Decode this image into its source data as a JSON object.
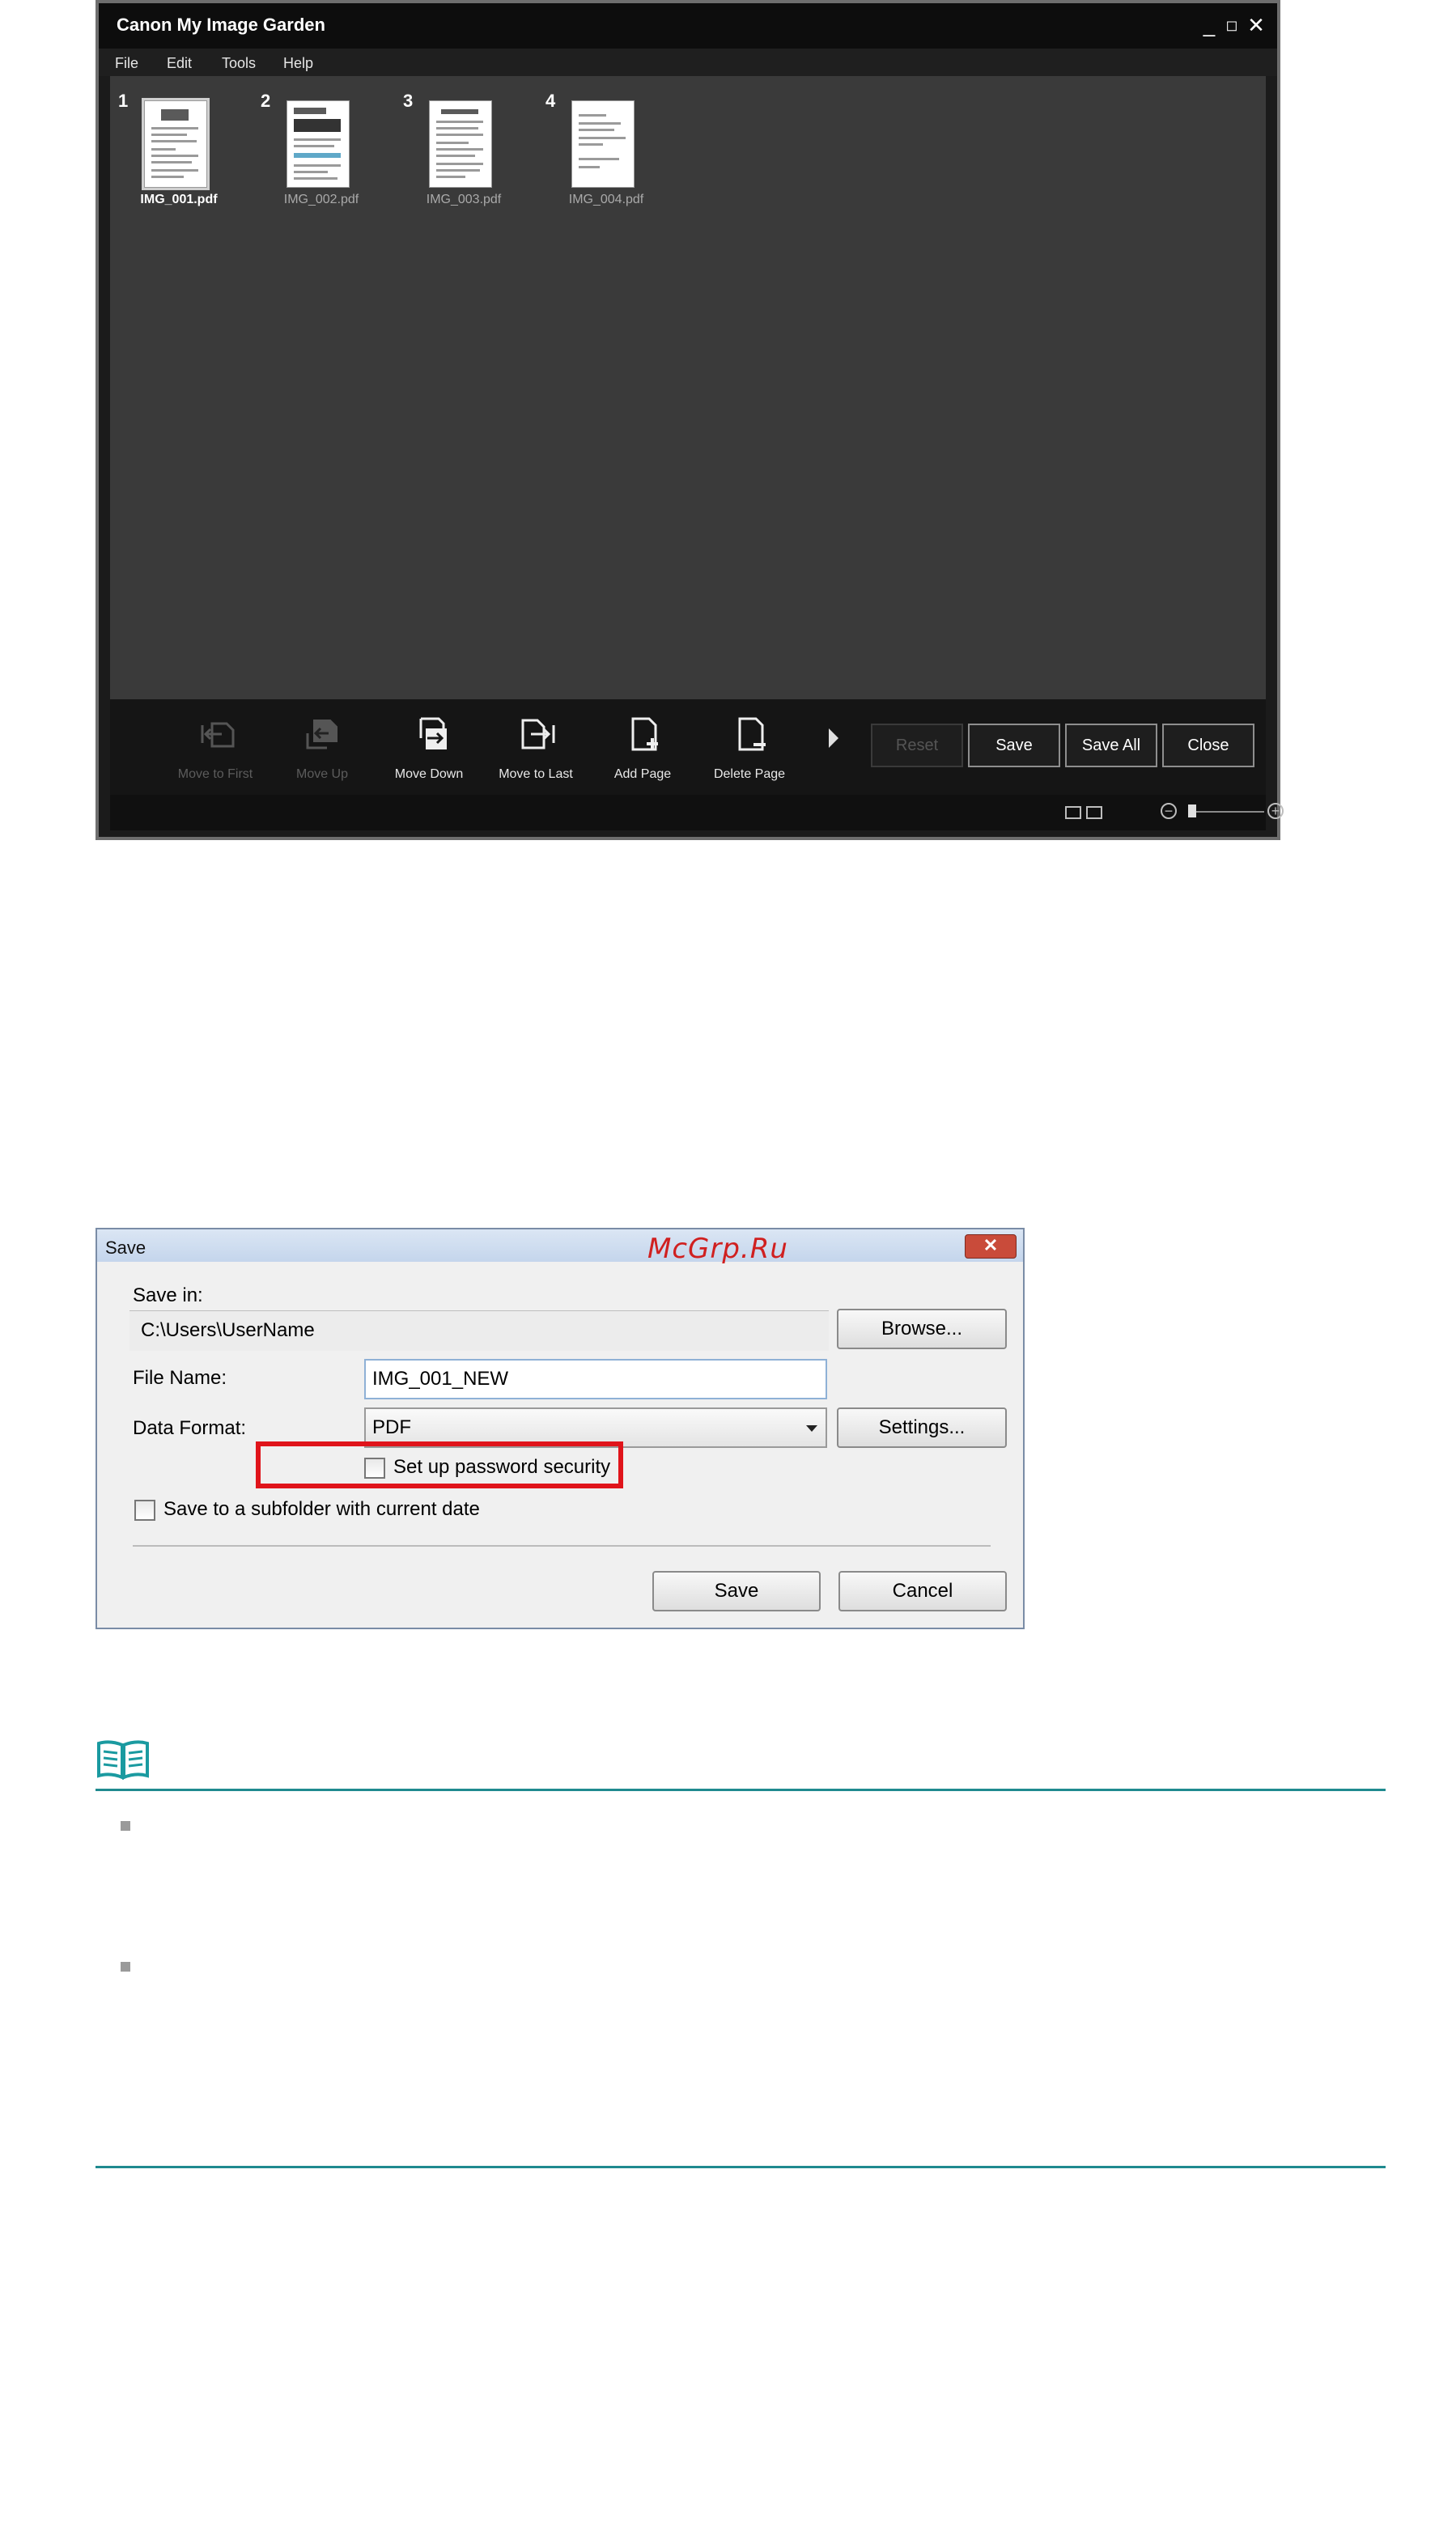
{
  "app": {
    "title": "Canon My Image Garden",
    "window_controls": [
      "minimize",
      "maximize",
      "close"
    ],
    "menu": [
      "File",
      "Edit",
      "Tools",
      "Help"
    ],
    "thumbnails": [
      {
        "number": "1",
        "filename": "IMG_001.pdf",
        "selected": true
      },
      {
        "number": "2",
        "filename": "IMG_002.pdf",
        "selected": false
      },
      {
        "number": "3",
        "filename": "IMG_003.pdf",
        "selected": false
      },
      {
        "number": "4",
        "filename": "IMG_004.pdf",
        "selected": false
      }
    ],
    "toolbar": {
      "move_to_first": "Move to First",
      "move_up": "Move Up",
      "move_down": "Move Down",
      "move_to_last": "Move to Last",
      "add_page": "Add Page",
      "delete_page": "Delete Page"
    },
    "buttons": {
      "reset": "Reset",
      "save": "Save",
      "save_all": "Save All",
      "close": "Close"
    },
    "zoom_level": 0.1
  },
  "save_dialog": {
    "title": "Save",
    "watermark": "McGrp.Ru",
    "save_in_label": "Save in:",
    "save_in_path": "C:\\Users\\UserName",
    "browse_button": "Browse...",
    "file_name_label": "File Name:",
    "file_name_value": "IMG_001_NEW",
    "data_format_label": "Data Format:",
    "data_format_value": "PDF",
    "settings_button": "Settings...",
    "password_checkbox_label": "Set up password security",
    "password_checked": false,
    "subfolder_checkbox_label": "Save to a subfolder with current date",
    "subfolder_checked": false,
    "save_button": "Save",
    "cancel_button": "Cancel"
  },
  "colors": {
    "highlight": "#e0141b",
    "rule": "#1f8a8f",
    "watermark": "#d02020"
  }
}
